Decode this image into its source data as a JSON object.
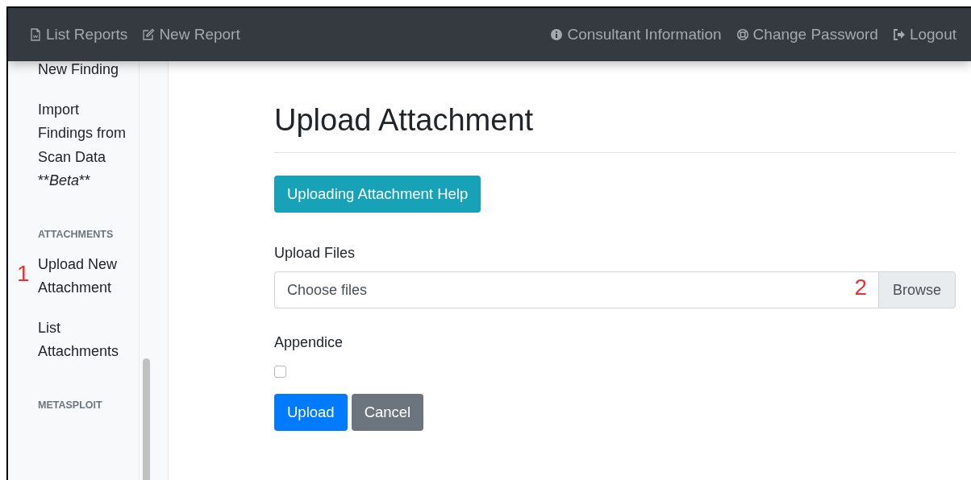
{
  "navbar": {
    "items": [
      {
        "label": "List Reports"
      },
      {
        "label": "New Report"
      },
      {
        "label": "Consultant Information"
      },
      {
        "label": "Change Password"
      },
      {
        "label": "Logout"
      }
    ]
  },
  "sidebar": {
    "items": [
      {
        "kind": "link",
        "label": "New Finding"
      },
      {
        "kind": "link",
        "label": "Import Findings from Scan Data",
        "note_before": "**",
        "note": "Beta",
        "note_after": "**"
      },
      {
        "kind": "heading",
        "label": "ATTACHMENTS"
      },
      {
        "kind": "link",
        "label": "Upload New Attachment",
        "marker": "1"
      },
      {
        "kind": "link",
        "label": "List Attachments"
      },
      {
        "kind": "heading",
        "label": "METASPLOIT"
      }
    ]
  },
  "page": {
    "title": "Upload Attachment",
    "help_button": "Uploading Attachment Help",
    "file_field": {
      "label": "Upload Files",
      "placeholder": "Choose files",
      "marker": "2",
      "button": "Browse"
    },
    "appendice": {
      "label": "Appendice",
      "checked": false
    },
    "buttons": [
      {
        "kind": "primary",
        "label": "Upload"
      },
      {
        "kind": "secondary",
        "label": "Cancel"
      }
    ]
  }
}
